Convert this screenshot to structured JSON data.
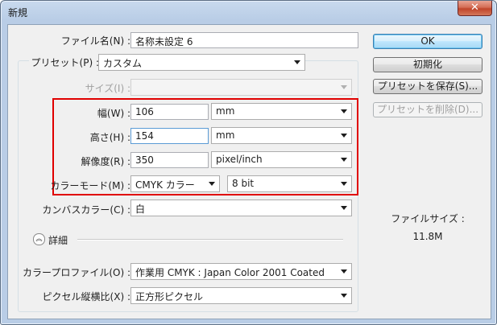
{
  "window": {
    "title": "新規",
    "close_label": "✕"
  },
  "form": {
    "name_label": "ファイル名(N) :",
    "name_value": "名称未設定 6",
    "preset_label": "プリセット(P) :",
    "preset_value": "カスタム",
    "size_label": "サイズ(I) :",
    "size_value": "",
    "width_label": "幅(W) :",
    "width_value": "106",
    "width_unit": "mm",
    "height_label": "高さ(H) :",
    "height_value": "154",
    "height_unit": "mm",
    "resolution_label": "解像度(R) :",
    "resolution_value": "350",
    "resolution_unit": "pixel/inch",
    "color_mode_label": "カラーモード(M) :",
    "color_mode_value": "CMYK カラー",
    "bit_depth_value": "8 bit",
    "bg_label": "カンバスカラー(C) :",
    "bg_value": "白",
    "details_label": "詳細",
    "profile_label": "カラープロファイル(O) :",
    "profile_value": "作業用 CMYK : Japan Color 2001 Coated",
    "aspect_label": "ピクセル縦横比(X) :",
    "aspect_value": "正方形ピクセル"
  },
  "buttons": {
    "ok": "OK",
    "reset": "初期化",
    "save_preset": "プリセットを保存(S)...",
    "delete_preset": "プリセットを削除(D)..."
  },
  "info": {
    "size_label": "ファイルサイズ :",
    "size_value": "11.8M"
  },
  "icons": {
    "details_toggle": "double-chevron-up-icon",
    "dropdown": "chevron-down-icon"
  }
}
